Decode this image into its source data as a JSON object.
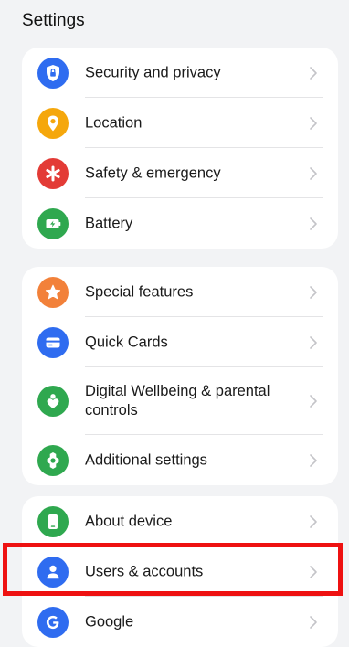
{
  "header": {
    "title": "Settings"
  },
  "groups": [
    {
      "items": [
        {
          "label": "Security and privacy",
          "icon": "shield-lock-icon",
          "color": "#2f6cf0"
        },
        {
          "label": "Location",
          "icon": "location-pin-icon",
          "color": "#f5a70c"
        },
        {
          "label": "Safety & emergency",
          "icon": "asterisk-icon",
          "color": "#e33b36"
        },
        {
          "label": "Battery",
          "icon": "battery-icon",
          "color": "#2fa84f"
        }
      ]
    },
    {
      "items": [
        {
          "label": "Special features",
          "icon": "star-icon",
          "color": "#f2813a"
        },
        {
          "label": "Quick Cards",
          "icon": "card-icon",
          "color": "#2f6cf0"
        },
        {
          "label": "Digital Wellbeing & parental controls",
          "icon": "heart-person-icon",
          "color": "#2fa84f"
        },
        {
          "label": "Additional settings",
          "icon": "gear-icon",
          "color": "#2fa84f"
        }
      ]
    },
    {
      "items": [
        {
          "label": "About device",
          "icon": "phone-icon",
          "color": "#2fa84f"
        },
        {
          "label": "Users & accounts",
          "icon": "user-icon",
          "color": "#2f6cf0"
        },
        {
          "label": "Google",
          "icon": "google-icon",
          "color": "#2f6cf0"
        }
      ]
    }
  ],
  "highlight": {
    "color": "#ee1111"
  }
}
